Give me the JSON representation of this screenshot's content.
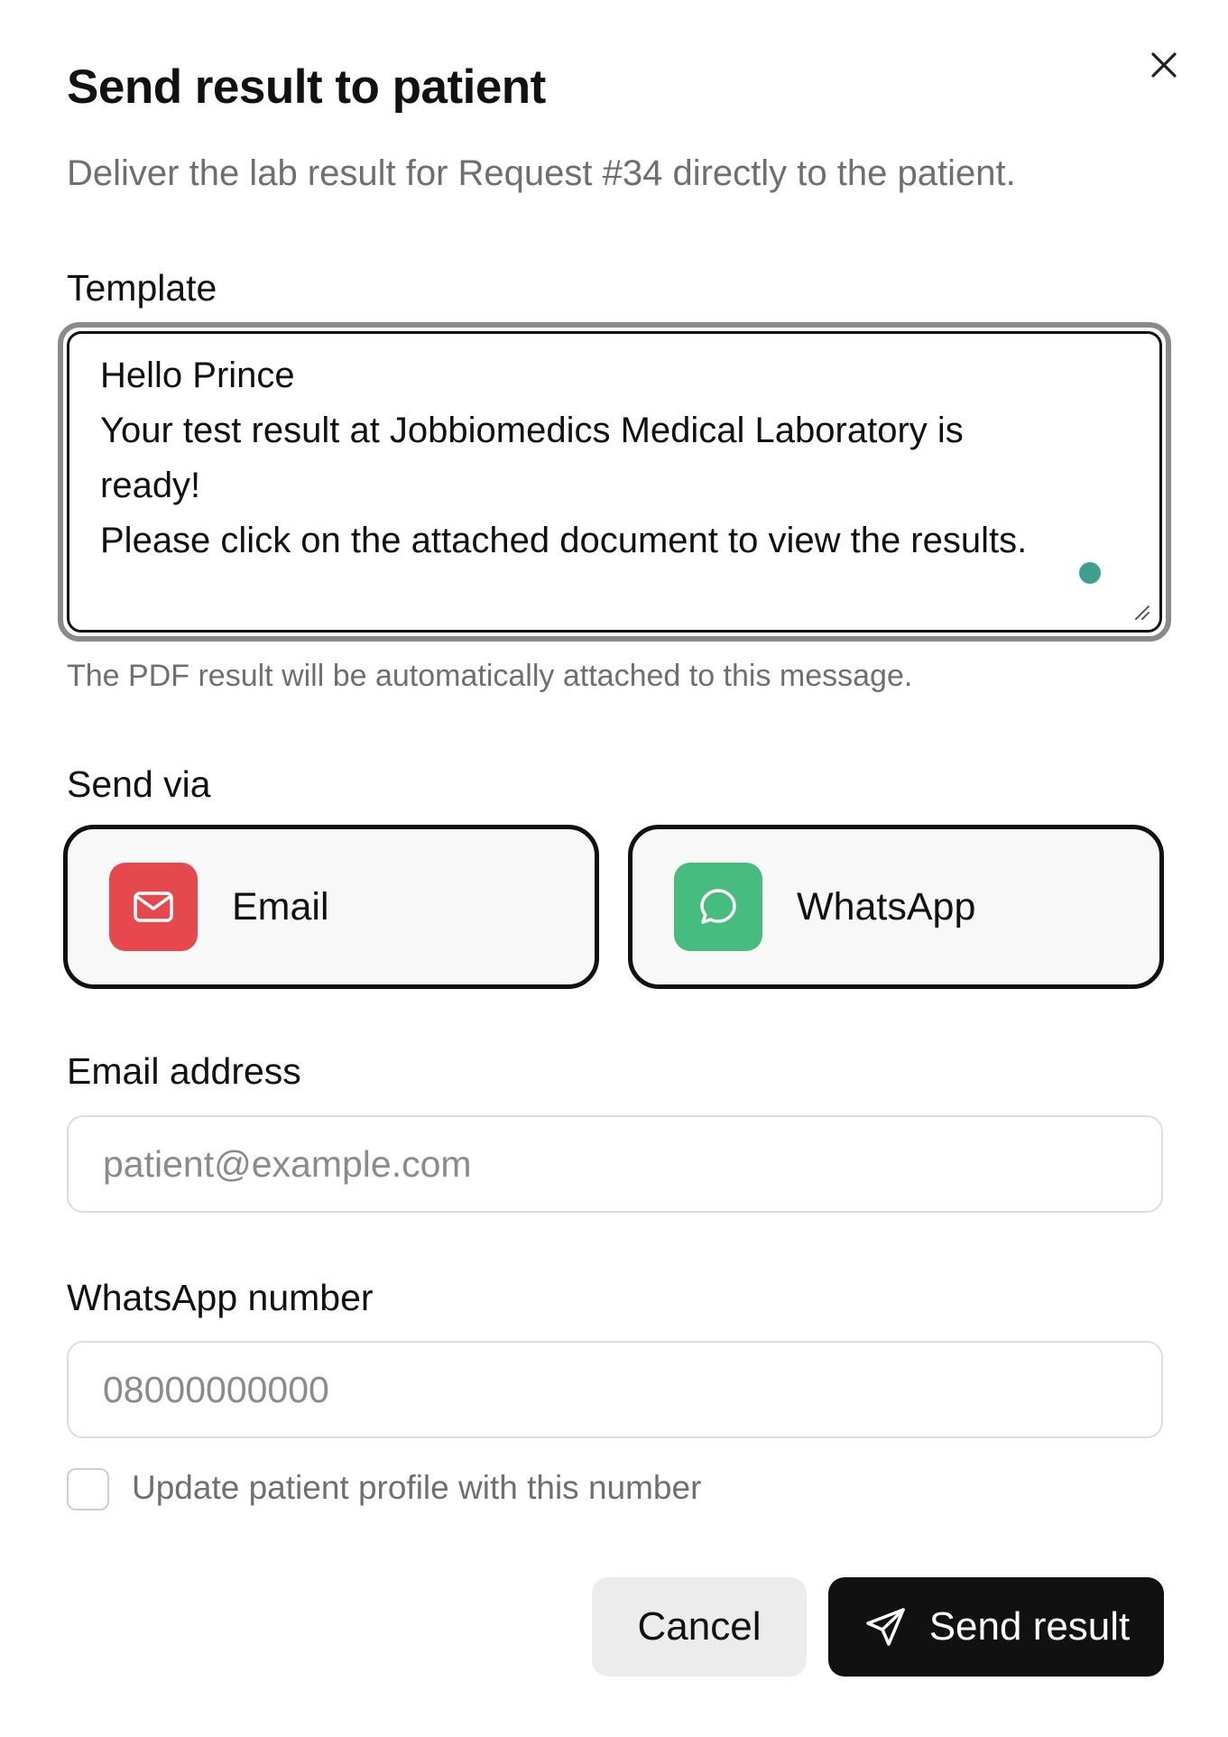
{
  "dialog": {
    "title": "Send result to patient",
    "subtitle": "Deliver the lab result for Request #34 directly to the patient.",
    "close_icon": "close-icon"
  },
  "template": {
    "label": "Template",
    "lines": [
      "Hello Prince",
      "Your test result at Jobbiomedics Medical Laboratory is",
      "ready!",
      "Please click on the attached document to view the results."
    ],
    "helper": "The PDF result will be automatically attached to this message."
  },
  "send_via": {
    "label": "Send via",
    "options": [
      {
        "label": "Email",
        "icon": "mail-icon",
        "icon_color": "#e5484d"
      },
      {
        "label": "WhatsApp",
        "icon": "chat-bubble-icon",
        "icon_color": "#46bc7f"
      }
    ]
  },
  "email": {
    "label": "Email address",
    "value": "",
    "placeholder": "patient@example.com"
  },
  "whatsapp": {
    "label": "WhatsApp number",
    "value": "",
    "placeholder": "08000000000",
    "update_profile_label": "Update patient profile with this number",
    "update_profile_checked": false
  },
  "actions": {
    "cancel_label": "Cancel",
    "send_label": "Send result",
    "send_icon": "send-icon"
  },
  "colors": {
    "primary_button": "#111111",
    "cursor_dot": "#3f9f8f"
  }
}
